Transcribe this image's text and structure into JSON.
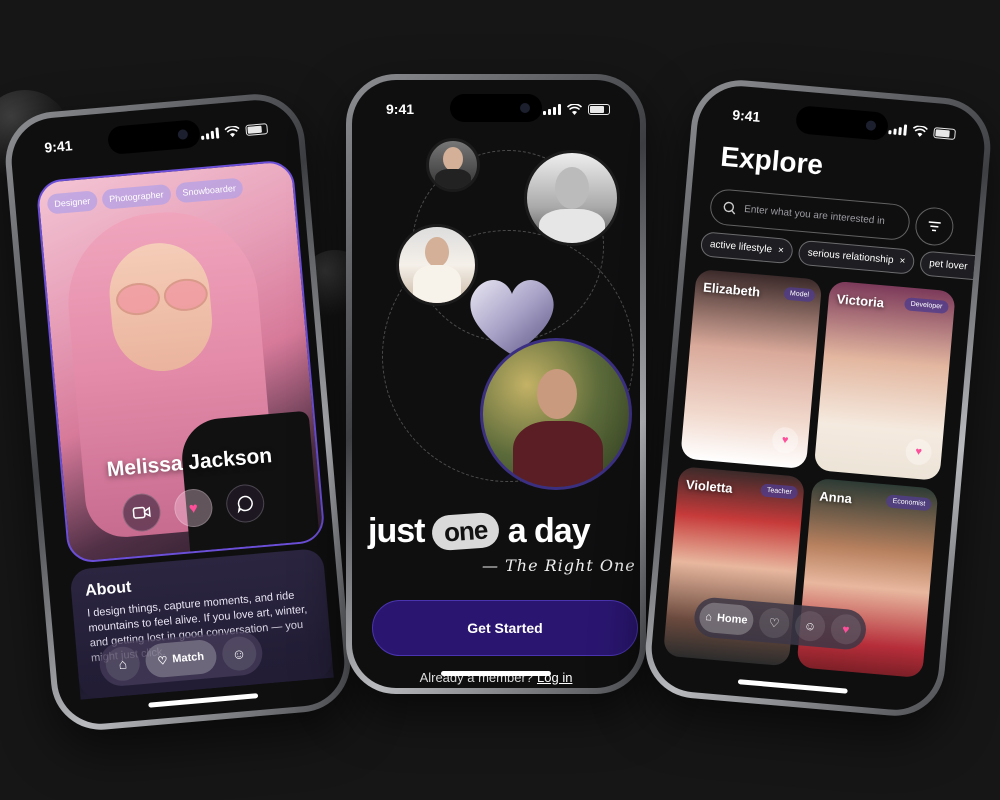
{
  "left_phone": {
    "time": "9:41",
    "tags": [
      "Designer",
      "Photographer",
      "Snowboarder"
    ],
    "profile_name": "Melissa Jackson",
    "about_title": "About",
    "about_text": "I design things, capture moments, and ride mountains to feel alive. If you love art, winter, and getting lost in good conversation — you might just click.",
    "nav_match_label": "Match"
  },
  "middle_phone": {
    "time": "9:41",
    "tagline_before": "just",
    "tagline_highlight": "one",
    "tagline_after": "a day",
    "subline": "— The Right One",
    "cta_label": "Get Started",
    "login_prompt": "Already a member?",
    "login_link": "Log in"
  },
  "right_phone": {
    "time": "9:41",
    "title": "Explore",
    "search_placeholder": "Enter what you are interested in",
    "chips": [
      {
        "label": "active lifestyle",
        "remove": "×"
      },
      {
        "label": "serious relationship",
        "remove": "×"
      },
      {
        "label": "pet lover",
        "remove": "×"
      }
    ],
    "profiles": [
      {
        "name": "Elizabeth",
        "role": "Model"
      },
      {
        "name": "Victoria",
        "role": "Developer"
      },
      {
        "name": "Violetta",
        "role": "Teacher"
      },
      {
        "name": "Anna",
        "role": "Economist"
      }
    ],
    "nav_home_label": "Home"
  },
  "icons": {
    "home": "⌂",
    "heart": "♥",
    "heart_outline": "♡",
    "user": "☺",
    "video": "▭",
    "chat": "◯",
    "search": "⌕",
    "filter": "≡",
    "close": "×"
  },
  "colors": {
    "accent": "#2a1670",
    "pink": "#ff4f9a",
    "background": "#161616"
  }
}
